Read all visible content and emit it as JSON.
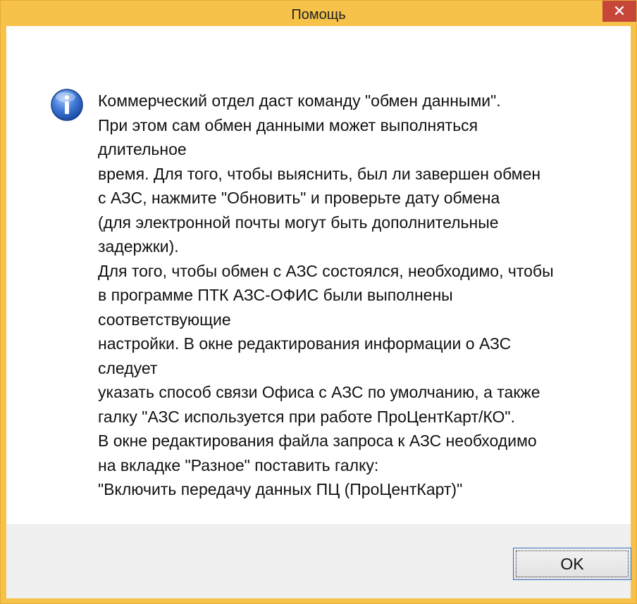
{
  "window": {
    "title": "Помощь",
    "close_symbol": "✕"
  },
  "message": {
    "icon": "info-icon",
    "lines": [
      "Коммерческий отдел даст команду \"обмен данными\".",
      "При этом сам обмен данными может выполняться",
      "длительное",
      "время. Для того, чтобы выяснить, был ли завершен обмен",
      "с АЗС, нажмите \"Обновить\" и проверьте дату обмена",
      "(для электронной почты могут быть дополнительные",
      "задержки).",
      "Для того, чтобы обмен с АЗС состоялся, необходимо, чтобы",
      "в программе ПТК АЗС-ОФИС были выполнены",
      "соответствующие",
      "настройки. В окне редактирования информации о АЗС",
      "следует",
      "указать способ связи Офиса с АЗС по умолчанию, а также",
      "галку \"АЗС используется при работе ПроЦентКарт/КО\".",
      "В окне редактирования файла запроса к АЗС необходимо",
      "на вкладке \"Разное\" поставить галку:",
      "\"Включить передачу данных ПЦ (ПроЦентКарт)\""
    ]
  },
  "buttons": {
    "ok_label": "OK"
  },
  "colors": {
    "titlebar": "#f6c24a",
    "close_button": "#c7463a",
    "footer": "#f0f0f0",
    "ok_border": "#2f6bbd"
  }
}
